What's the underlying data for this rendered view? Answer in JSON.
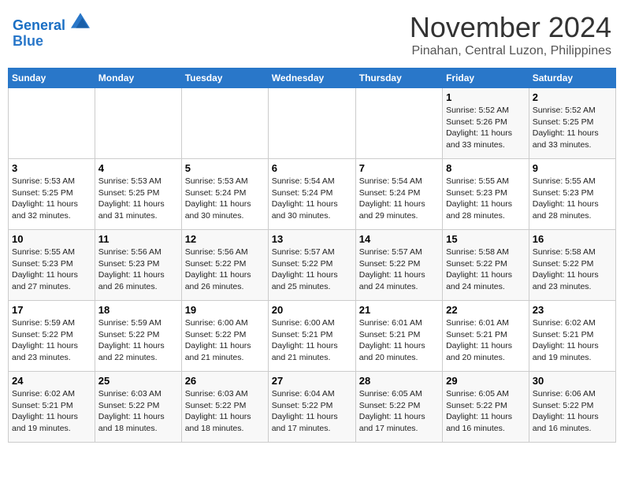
{
  "header": {
    "logo_line1": "General",
    "logo_line2": "Blue",
    "month": "November 2024",
    "location": "Pinahan, Central Luzon, Philippines"
  },
  "weekdays": [
    "Sunday",
    "Monday",
    "Tuesday",
    "Wednesday",
    "Thursday",
    "Friday",
    "Saturday"
  ],
  "weeks": [
    [
      {
        "day": "",
        "info": ""
      },
      {
        "day": "",
        "info": ""
      },
      {
        "day": "",
        "info": ""
      },
      {
        "day": "",
        "info": ""
      },
      {
        "day": "",
        "info": ""
      },
      {
        "day": "1",
        "info": "Sunrise: 5:52 AM\nSunset: 5:26 PM\nDaylight: 11 hours\nand 33 minutes."
      },
      {
        "day": "2",
        "info": "Sunrise: 5:52 AM\nSunset: 5:25 PM\nDaylight: 11 hours\nand 33 minutes."
      }
    ],
    [
      {
        "day": "3",
        "info": "Sunrise: 5:53 AM\nSunset: 5:25 PM\nDaylight: 11 hours\nand 32 minutes."
      },
      {
        "day": "4",
        "info": "Sunrise: 5:53 AM\nSunset: 5:25 PM\nDaylight: 11 hours\nand 31 minutes."
      },
      {
        "day": "5",
        "info": "Sunrise: 5:53 AM\nSunset: 5:24 PM\nDaylight: 11 hours\nand 30 minutes."
      },
      {
        "day": "6",
        "info": "Sunrise: 5:54 AM\nSunset: 5:24 PM\nDaylight: 11 hours\nand 30 minutes."
      },
      {
        "day": "7",
        "info": "Sunrise: 5:54 AM\nSunset: 5:24 PM\nDaylight: 11 hours\nand 29 minutes."
      },
      {
        "day": "8",
        "info": "Sunrise: 5:55 AM\nSunset: 5:23 PM\nDaylight: 11 hours\nand 28 minutes."
      },
      {
        "day": "9",
        "info": "Sunrise: 5:55 AM\nSunset: 5:23 PM\nDaylight: 11 hours\nand 28 minutes."
      }
    ],
    [
      {
        "day": "10",
        "info": "Sunrise: 5:55 AM\nSunset: 5:23 PM\nDaylight: 11 hours\nand 27 minutes."
      },
      {
        "day": "11",
        "info": "Sunrise: 5:56 AM\nSunset: 5:23 PM\nDaylight: 11 hours\nand 26 minutes."
      },
      {
        "day": "12",
        "info": "Sunrise: 5:56 AM\nSunset: 5:22 PM\nDaylight: 11 hours\nand 26 minutes."
      },
      {
        "day": "13",
        "info": "Sunrise: 5:57 AM\nSunset: 5:22 PM\nDaylight: 11 hours\nand 25 minutes."
      },
      {
        "day": "14",
        "info": "Sunrise: 5:57 AM\nSunset: 5:22 PM\nDaylight: 11 hours\nand 24 minutes."
      },
      {
        "day": "15",
        "info": "Sunrise: 5:58 AM\nSunset: 5:22 PM\nDaylight: 11 hours\nand 24 minutes."
      },
      {
        "day": "16",
        "info": "Sunrise: 5:58 AM\nSunset: 5:22 PM\nDaylight: 11 hours\nand 23 minutes."
      }
    ],
    [
      {
        "day": "17",
        "info": "Sunrise: 5:59 AM\nSunset: 5:22 PM\nDaylight: 11 hours\nand 23 minutes."
      },
      {
        "day": "18",
        "info": "Sunrise: 5:59 AM\nSunset: 5:22 PM\nDaylight: 11 hours\nand 22 minutes."
      },
      {
        "day": "19",
        "info": "Sunrise: 6:00 AM\nSunset: 5:22 PM\nDaylight: 11 hours\nand 21 minutes."
      },
      {
        "day": "20",
        "info": "Sunrise: 6:00 AM\nSunset: 5:21 PM\nDaylight: 11 hours\nand 21 minutes."
      },
      {
        "day": "21",
        "info": "Sunrise: 6:01 AM\nSunset: 5:21 PM\nDaylight: 11 hours\nand 20 minutes."
      },
      {
        "day": "22",
        "info": "Sunrise: 6:01 AM\nSunset: 5:21 PM\nDaylight: 11 hours\nand 20 minutes."
      },
      {
        "day": "23",
        "info": "Sunrise: 6:02 AM\nSunset: 5:21 PM\nDaylight: 11 hours\nand 19 minutes."
      }
    ],
    [
      {
        "day": "24",
        "info": "Sunrise: 6:02 AM\nSunset: 5:21 PM\nDaylight: 11 hours\nand 19 minutes."
      },
      {
        "day": "25",
        "info": "Sunrise: 6:03 AM\nSunset: 5:22 PM\nDaylight: 11 hours\nand 18 minutes."
      },
      {
        "day": "26",
        "info": "Sunrise: 6:03 AM\nSunset: 5:22 PM\nDaylight: 11 hours\nand 18 minutes."
      },
      {
        "day": "27",
        "info": "Sunrise: 6:04 AM\nSunset: 5:22 PM\nDaylight: 11 hours\nand 17 minutes."
      },
      {
        "day": "28",
        "info": "Sunrise: 6:05 AM\nSunset: 5:22 PM\nDaylight: 11 hours\nand 17 minutes."
      },
      {
        "day": "29",
        "info": "Sunrise: 6:05 AM\nSunset: 5:22 PM\nDaylight: 11 hours\nand 16 minutes."
      },
      {
        "day": "30",
        "info": "Sunrise: 6:06 AM\nSunset: 5:22 PM\nDaylight: 11 hours\nand 16 minutes."
      }
    ]
  ]
}
